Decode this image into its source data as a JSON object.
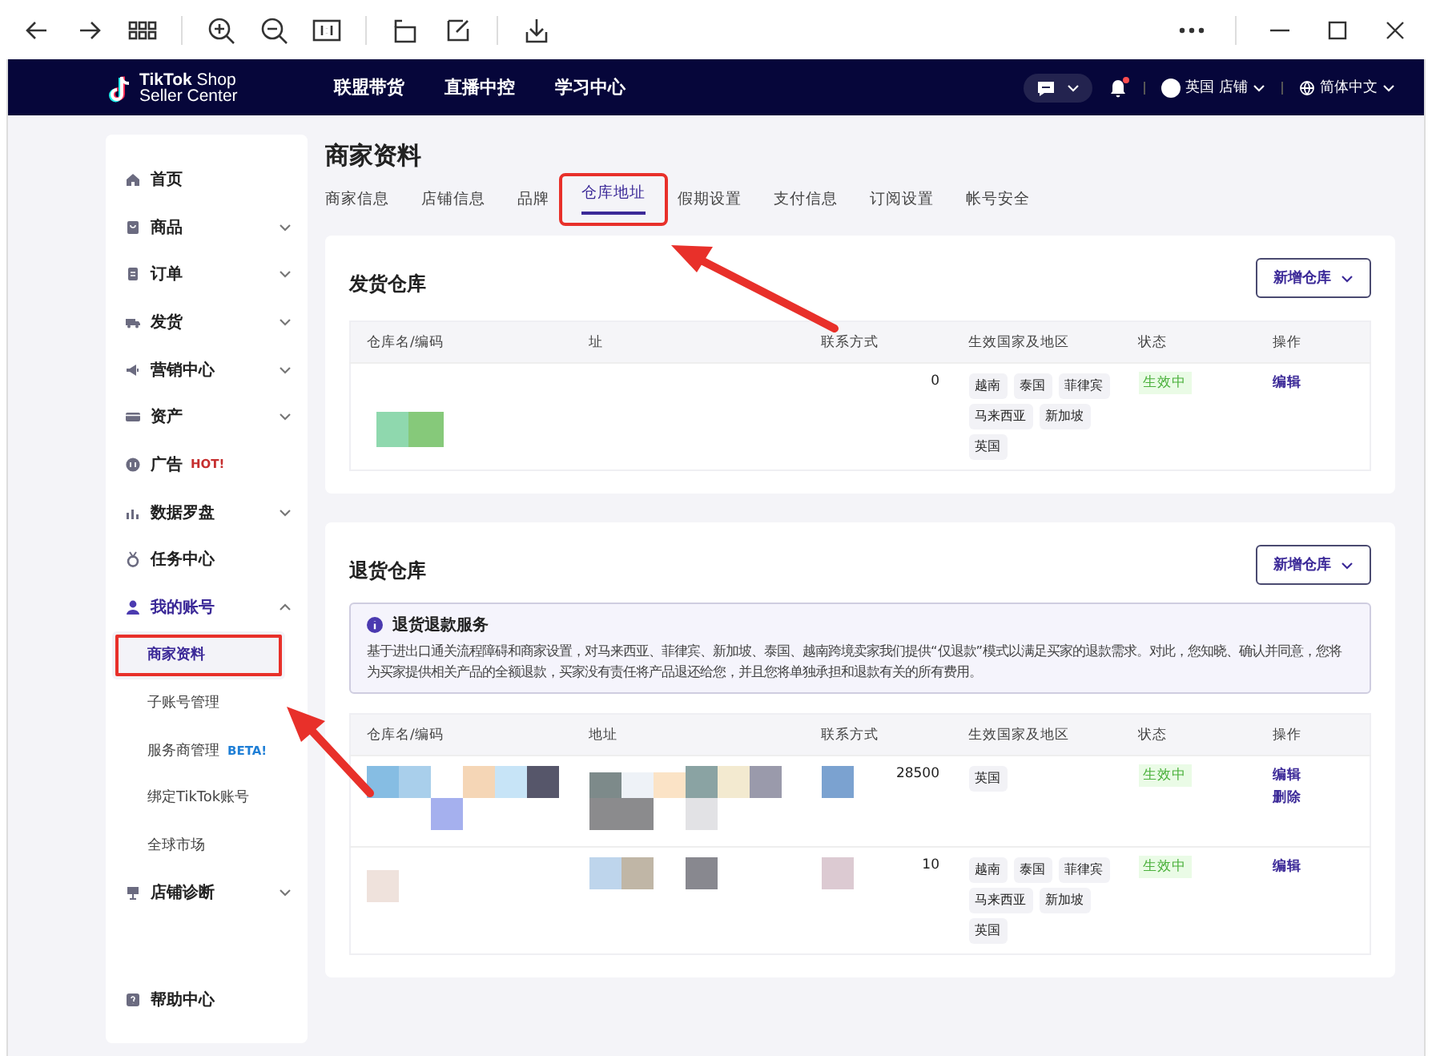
{
  "header": {
    "logo_top": "TikTok Shop",
    "logo_bottom": "Seller Center",
    "nav": [
      "联盟带货",
      "直播中控",
      "学习中心"
    ],
    "has_notification": true,
    "shop": "英国 店铺",
    "language": "简体中文"
  },
  "sidebar": {
    "items": [
      {
        "label": "首页"
      },
      {
        "label": "商品",
        "expanded": false
      },
      {
        "label": "订单",
        "expanded": false
      },
      {
        "label": "发货",
        "expanded": false
      },
      {
        "label": "营销中心",
        "expanded": false
      },
      {
        "label": "资产",
        "expanded": false
      },
      {
        "label": "广告",
        "badge": {
          "text": "HOT!",
          "color": "#c62f2f"
        }
      },
      {
        "label": "数据罗盘",
        "expanded": false
      },
      {
        "label": "任务中心"
      },
      {
        "label": "我的账号",
        "expanded": true,
        "children": [
          {
            "label": "商家资料",
            "selected": true,
            "highlighted": true
          },
          {
            "label": "子账号管理",
            "selected": false,
            "highlighted": false
          },
          {
            "label": "服务商管理",
            "selected": false,
            "highlighted": false,
            "badge": {
              "text": "BETA!",
              "color": "#1f7fd6"
            }
          },
          {
            "label": "绑定TikTok账号",
            "selected": false,
            "highlighted": false
          },
          {
            "label": "全球市场",
            "selected": false,
            "highlighted": false
          }
        ]
      },
      {
        "label": "店铺诊断",
        "expanded": false
      },
      {
        "label": "帮助中心"
      }
    ]
  },
  "page": {
    "title": "商家资料",
    "tabs": [
      {
        "label": "商家信息",
        "selected": false,
        "highlighted": false
      },
      {
        "label": "店铺信息",
        "selected": false,
        "highlighted": false
      },
      {
        "label": "品牌",
        "selected": false,
        "highlighted": false
      },
      {
        "label": "仓库地址",
        "selected": true,
        "highlighted": true
      },
      {
        "label": "假期设置",
        "selected": false,
        "highlighted": false
      },
      {
        "label": "支付信息",
        "selected": false,
        "highlighted": false
      },
      {
        "label": "订阅设置",
        "selected": false,
        "highlighted": false
      },
      {
        "label": "帐号安全",
        "selected": false,
        "highlighted": false
      }
    ],
    "sections": [
      {
        "title": "发货仓库",
        "add_button": "新增仓库",
        "columns": [
          "仓库名/编码",
          "址",
          "联系方式",
          "生效国家及地区",
          "状态",
          "操作"
        ],
        "rows": [
          {
            "contact": "0",
            "regions": [
              "越南",
              "泰国",
              "菲律宾",
              "马来西亚",
              "新加坡",
              "英国"
            ],
            "status": "生效中",
            "actions": [
              "编辑"
            ]
          }
        ]
      },
      {
        "title": "退货仓库",
        "add_button": "新增仓库",
        "notice": {
          "title": "退货退款服务",
          "text": "基于进出口通关流程障碍和商家设置，对马来西亚、菲律宾、新加坡、泰国、越南跨境卖家我们提供“仅退款”模式以满足买家的退款需求。对此，您知晓、确认并同意，您将为买家提供相关产品的全额退款，买家没有责任将产品退还给您，并且您将单独承担和退款有关的所有费用。"
        },
        "columns": [
          "仓库名/编码",
          "地址",
          "联系方式",
          "生效国家及地区",
          "状态",
          "操作"
        ],
        "rows": [
          {
            "contact": "28500",
            "regions": [
              "英国"
            ],
            "status": "生效中",
            "actions": [
              "编辑",
              "删除"
            ]
          },
          {
            "contact": "10",
            "regions": [
              "越南",
              "泰国",
              "菲律宾",
              "马来西亚",
              "新加坡",
              "英国"
            ],
            "status": "生效中",
            "actions": [
              "编辑"
            ]
          }
        ]
      }
    ]
  }
}
